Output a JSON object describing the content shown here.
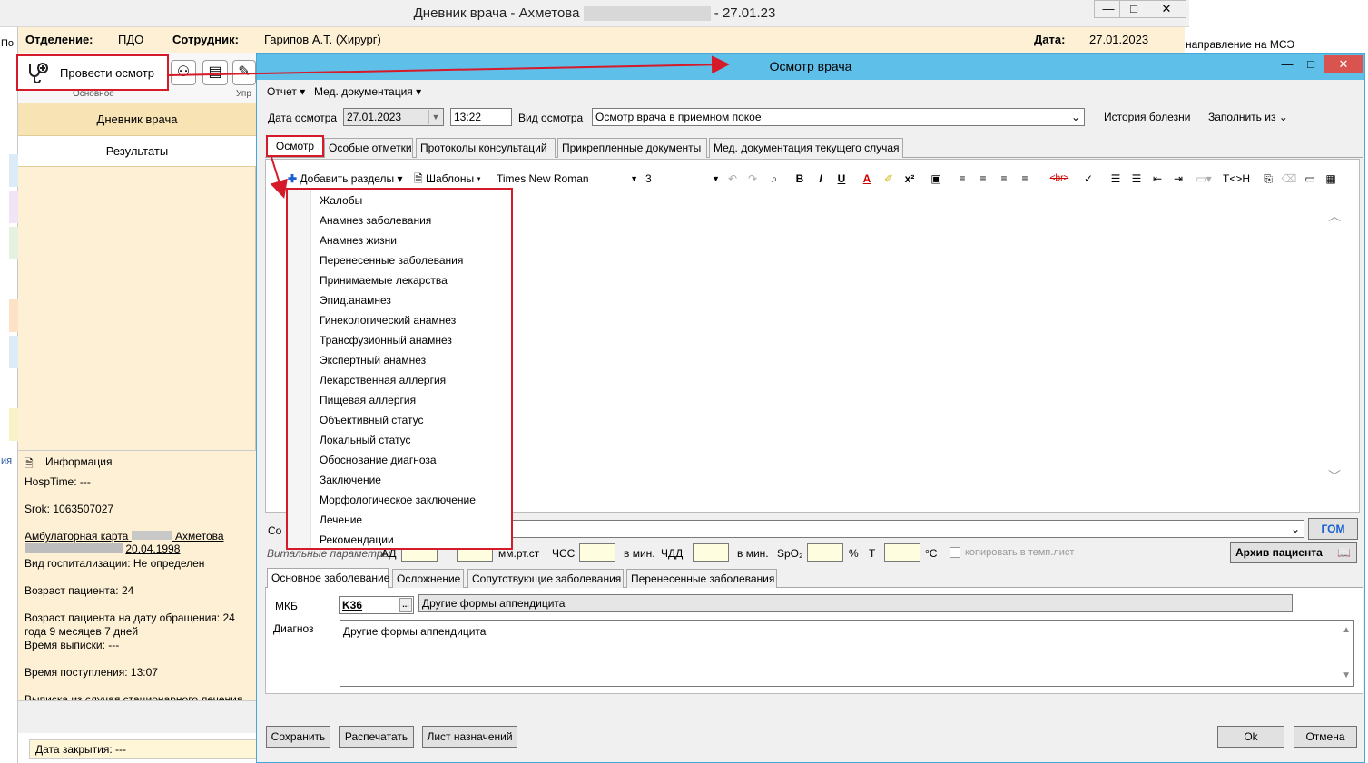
{
  "background_window": {
    "title": "Дневник врача - Ахметова",
    "title_date": "- 27.01.23",
    "header": {
      "department_label": "Отделение:",
      "department_value": "ПДО",
      "employee_label": "Сотрудник:",
      "employee_value": "Гарипов А.Т. (Хирург)",
      "date_label": "Дата:",
      "date_value": "27.01.2023"
    },
    "left_edge_text": "По",
    "left_edge_text2": "ия",
    "right_text": "направление на МСЭ",
    "toolbar": {
      "exam_button": "Провести осмотр",
      "section_main": "Основное",
      "section_manage": "Упр"
    },
    "nav": {
      "diary": "Дневник врача",
      "results": "Результаты"
    },
    "info": {
      "header": "Информация",
      "hosptime": "HospTime: ---",
      "srok": "Srok: 1063507027",
      "amb_card_prefix": "Амбулаторная карта",
      "amb_card_name": "Ахметова",
      "birth_date": "20.04.1998",
      "hosp_type": "Вид госпитализации: Не определен",
      "age": "Возраст пациента: 24",
      "age_at_visit_1": "Возраст пациента на дату обращения: 24",
      "age_at_visit_2": "года 9 месяцев 7 дней",
      "discharge_time": "Время выписки: ---",
      "admission_time": "Время поступления: 13:07",
      "extract": "Выписка из случая стационарного лечения"
    },
    "closing_date": "Дата закрытия: ---"
  },
  "dialog": {
    "title": "Осмотр врача",
    "menu": {
      "report": "Отчет",
      "med_docs": "Мед. документация"
    },
    "exam_date_label": "Дата осмотра",
    "exam_date_value": "27.01.2023",
    "exam_time_value": "13:22",
    "exam_type_label": "Вид осмотра",
    "exam_type_value": "Осмотр врача в приемном покое",
    "history_button": "История болезни",
    "fill_from_button": "Заполнить из",
    "tabs": [
      "Осмотр",
      "Особые отметки",
      "Протоколы консультаций",
      "Прикрепленные документы",
      "Мед. документация текущего случая"
    ],
    "editor_toolbar": {
      "add_sections": "Добавить разделы",
      "templates": "Шаблоны",
      "font": "Times New Roman",
      "size": "3",
      "t_h_button": "T<>H"
    },
    "sections_menu": [
      "Жалобы",
      "Анамнез заболевания",
      "Анамнез жизни",
      "Перенесенные заболевания",
      "Принимаемые лекарства",
      "Эпид.анамнез",
      "Гинекологический анамнез",
      "Трансфузионный анамнез",
      "Экспертный анамнез",
      "Лекарственная аллергия",
      "Пищевая аллергия",
      "Объективный статус",
      "Локальный статус",
      "Обоснование диагноза",
      "Заключение",
      "Морфологическое заключение",
      "Лечение",
      "Рекомендации"
    ],
    "row_prefix": "Со",
    "gom_button": "ГОМ",
    "vitals": {
      "label": "Витальные параметры",
      "ad_label": "АД",
      "ad_unit": "мм.рт.ст",
      "hr_label": "ЧСС",
      "hr_unit": "в мин.",
      "rr_label": "ЧДД",
      "rr_unit": "в мин.",
      "spo2_label": "SpO₂",
      "spo2_unit": "%",
      "temp_label": "Т",
      "temp_unit": "°С",
      "copy_label": "копировать в темп.лист"
    },
    "archive_button": "Архив пациента",
    "diag_tabs": [
      "Основное заболевание",
      "Осложнение",
      "Сопутствующие заболевания",
      "Перенесенные заболевания"
    ],
    "mkb_label": "МКБ",
    "mkb_code": "K36",
    "mkb_name": "Другие формы аппендицита",
    "diagnosis_label": "Диагноз",
    "diagnosis_text": "Другие формы аппендицита",
    "footer": {
      "save": "Сохранить",
      "print": "Распечатать",
      "prescriptions": "Лист назначений",
      "ok": "Ok",
      "cancel": "Отмена"
    }
  },
  "colors": {
    "highlight": "#d51a2a",
    "dialog_title": "#5ebfe9",
    "panel": "#fdf0d5"
  }
}
